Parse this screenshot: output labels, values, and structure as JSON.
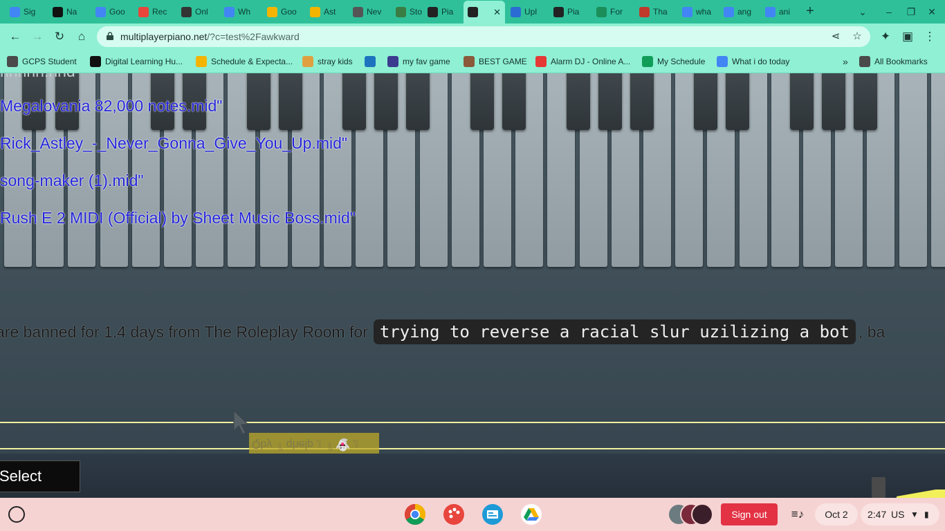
{
  "tabs": [
    {
      "label": "Sig",
      "icon": "google-icon",
      "color": "#4285f4"
    },
    {
      "label": "Na",
      "icon": "d2l-icon",
      "color": "#111111"
    },
    {
      "label": "Goo",
      "icon": "google-docs-icon",
      "color": "#4285f4"
    },
    {
      "label": "Rec",
      "icon": "gift-icon",
      "color": "#e8453c"
    },
    {
      "label": "Onl",
      "icon": "film-icon",
      "color": "#333333"
    },
    {
      "label": "Wh",
      "icon": "google-docs-icon",
      "color": "#4285f4"
    },
    {
      "label": "Goo",
      "icon": "google-slides-icon",
      "color": "#f4b400"
    },
    {
      "label": "Ast",
      "icon": "google-slides-icon",
      "color": "#f4b400"
    },
    {
      "label": "Nev",
      "icon": "globe-icon",
      "color": "#555555"
    },
    {
      "label": "Sto",
      "icon": "pin-icon",
      "color": "#3a7d44"
    },
    {
      "label": "Pia",
      "icon": "piano-icon",
      "color": "#222222"
    },
    {
      "label": "",
      "icon": "piano-icon",
      "color": "#222222"
    },
    {
      "label": "Upl",
      "icon": "ibb-icon",
      "color": "#2b6cd4"
    },
    {
      "label": "Pia",
      "icon": "piano-icon",
      "color": "#222222"
    },
    {
      "label": "For",
      "icon": "form-icon",
      "color": "#1b8e5a"
    },
    {
      "label": "Tha",
      "icon": "got-icon",
      "color": "#c0392b"
    },
    {
      "label": "wha",
      "icon": "google-icon",
      "color": "#4285f4"
    },
    {
      "label": "ang",
      "icon": "google-icon",
      "color": "#4285f4"
    },
    {
      "label": "ani",
      "icon": "google-icon",
      "color": "#4285f4"
    }
  ],
  "toolbar": {
    "url_host": "multiplayerpiano.net",
    "url_path": "/?c=test%2Fawkward"
  },
  "bookmarks": [
    {
      "label": "GCPS Student",
      "icon": "folder-icon",
      "color": "#4a4a4a"
    },
    {
      "label": "Digital Learning Hu...",
      "icon": "d2l-icon",
      "color": "#111111"
    },
    {
      "label": "Schedule & Expecta...",
      "icon": "google-slides-icon",
      "color": "#f4b400"
    },
    {
      "label": "stray kids",
      "icon": "pinterest-icon",
      "color": "#e0a040"
    },
    {
      "label": "",
      "icon": "edge-icon",
      "color": "#1e73be"
    },
    {
      "label": "my fav game",
      "icon": "game-icon",
      "color": "#3b3b8f"
    },
    {
      "label": "BEST GAME",
      "icon": "face-icon",
      "color": "#8a5a3a"
    },
    {
      "label": "Alarm DJ - Online A...",
      "icon": "alarm-icon",
      "color": "#e53935"
    },
    {
      "label": "My Schedule",
      "icon": "google-sheets-icon",
      "color": "#0f9d58"
    },
    {
      "label": "What i do today",
      "icon": "google-docs-icon",
      "color": "#4285f4"
    }
  ],
  "bookmarks_overflow": "»",
  "all_bookmarks": "All Bookmarks",
  "page": {
    "cut_line": "nnnnn.nnd",
    "midi_files": [
      "Megalovania 82,000 notes.mid\"",
      "Rick_Astley_-_Never_Gonna_Give_You_Up.mid\"",
      "song-maker (1).mid\"",
      "Rush E 2 MIDI (Official) by Sheet Music Boss.mid\""
    ],
    "ban_prefix": "are banned for 1.4 days from The Roleplay Room for",
    "ban_reason": "trying to reverse a racial slur uzilizing a bot",
    "ban_suffix": ", ba",
    "ghost_name": "Qby『 qheĺp 』『 👻 』",
    "select_label": "Select"
  },
  "shelf": {
    "signout": "Sign out",
    "date": "Oct 2",
    "time": "2:47",
    "region": "US"
  }
}
